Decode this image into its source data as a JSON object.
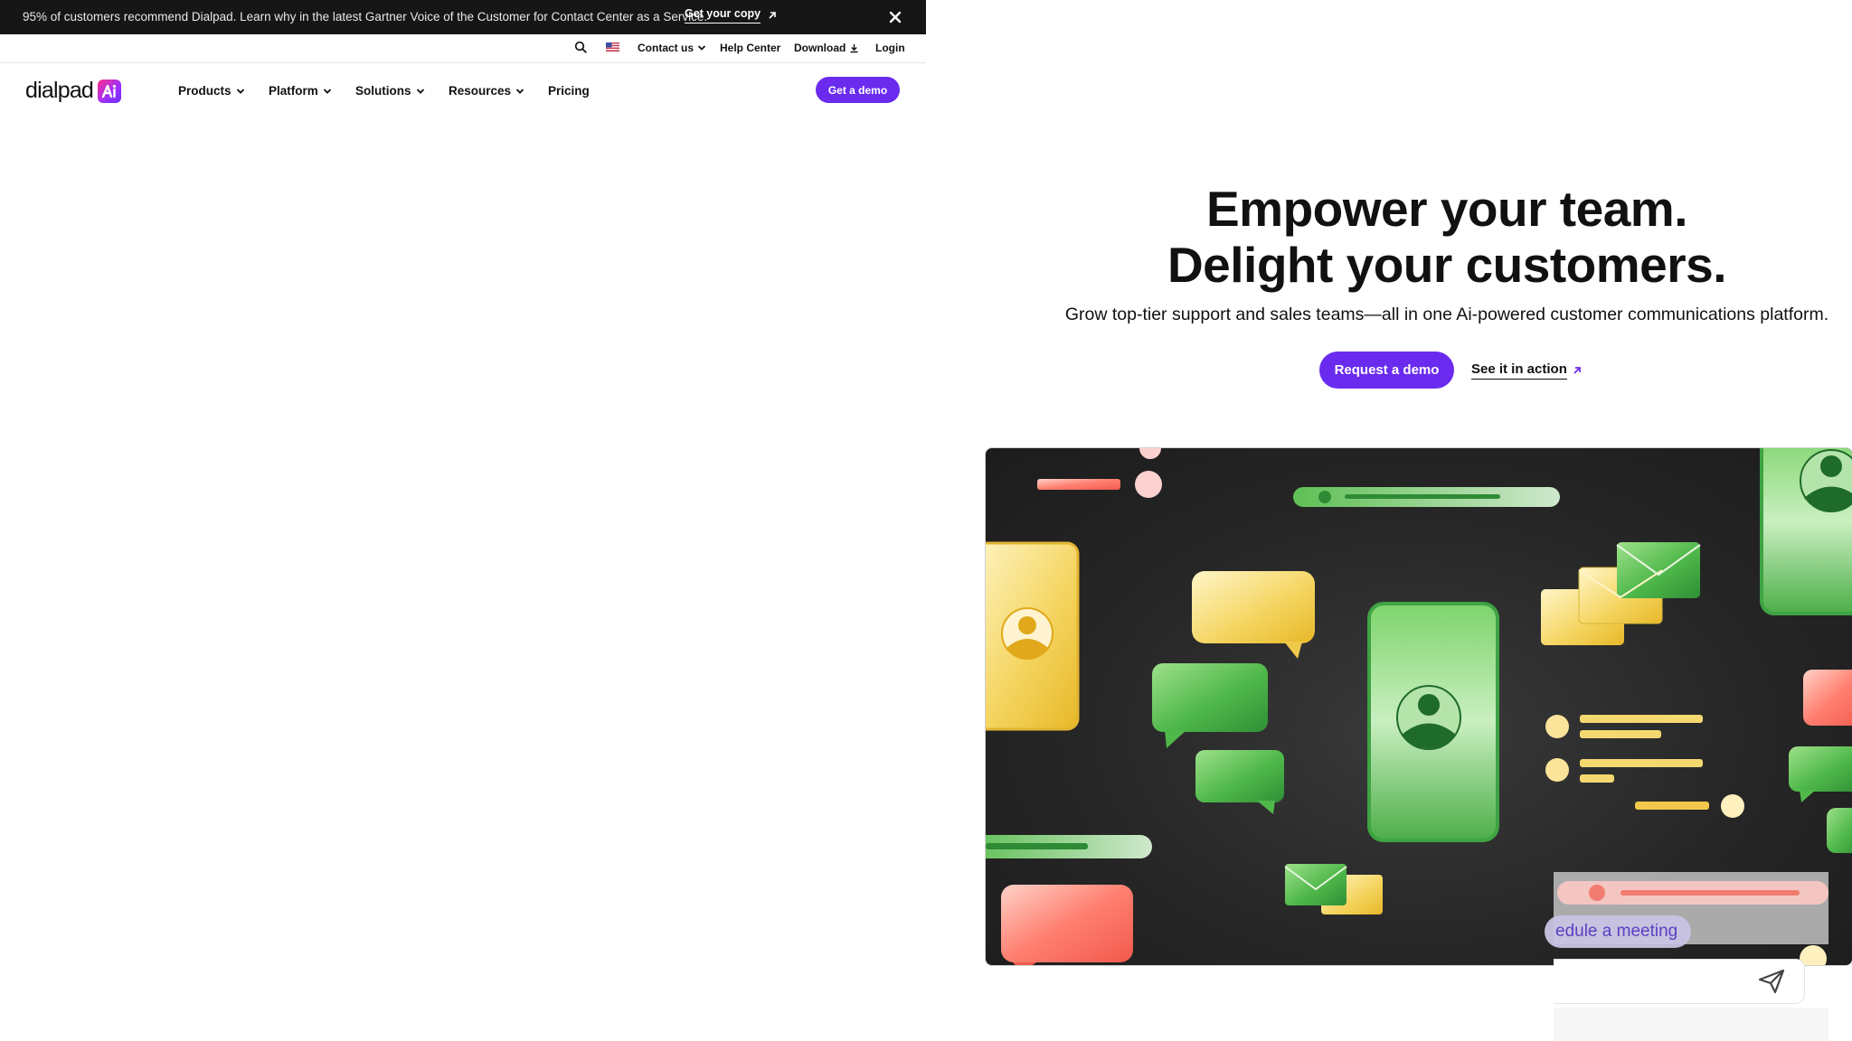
{
  "announcement": {
    "message": "95% of customers recommend Dialpad. Learn why in the latest Gartner Voice of the Customer for Contact Center as a Service.",
    "cta_label": "Get your copy",
    "close_icon": "close-icon"
  },
  "utility_nav": {
    "contact_label": "Contact us",
    "help_label": "Help Center",
    "download_label": "Download",
    "login_label": "Login"
  },
  "nav": {
    "logo_text": "dialpad",
    "items": [
      {
        "label": "Products"
      },
      {
        "label": "Platform"
      },
      {
        "label": "Solutions"
      },
      {
        "label": "Resources"
      },
      {
        "label": "Pricing"
      }
    ],
    "cta_label": "Get a demo"
  },
  "hero": {
    "title_line1": "Empower your team.",
    "title_line2": "Delight your customers.",
    "subtitle": "Grow top-tier support and sales teams—all in one Ai-powered customer communications platform.",
    "primary_cta": "Request a demo",
    "secondary_cta": "See it in action"
  },
  "chat_widget": {
    "bubble_text": "edule a meeting"
  },
  "colors": {
    "brand_purple": "#6a2bef",
    "dark_bar": "#161616",
    "illustration_bg": "#262626"
  }
}
